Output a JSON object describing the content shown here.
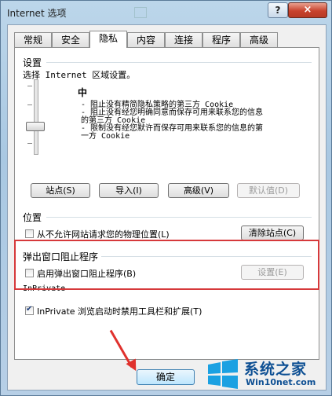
{
  "window": {
    "title": "Internet 选项",
    "help_label": "?",
    "close_label": "×"
  },
  "tabs": [
    "常规",
    "安全",
    "隐私",
    "内容",
    "连接",
    "程序",
    "高级"
  ],
  "active_tab": "隐私",
  "settings": {
    "group_label": "设置",
    "zone_prompt": "选择 Internet 区域设置。",
    "level_name": "中",
    "level_fraction": 0.5,
    "desc_lines": [
      "- 阻止没有精简隐私策略的第三方 Cookie",
      "- 阻止没有经您明确同意而保存可用来联系您的信息",
      "的第三方 Cookie",
      "- 限制没有经您默许而保存可用来联系您的信息的第",
      "一方 Cookie"
    ],
    "buttons": {
      "sites": "站点(S)",
      "import": "导入(I)",
      "advanced": "高级(V)",
      "default": "默认值(D)"
    }
  },
  "location": {
    "group_label": "位置",
    "checkbox_label": "从不允许网站请求您的物理位置(L)",
    "checked": false,
    "clear_button": "清除站点(C)"
  },
  "popup": {
    "group_label": "弹出窗口阻止程序",
    "checkbox_label": "启用弹出窗口阻止程序(B)",
    "checked": false,
    "settings_button": "设置(E)"
  },
  "inprivate": {
    "group_label": "InPrivate",
    "checkbox_label": "InPrivate 浏览启动时禁用工具栏和扩展(T)",
    "checked": true
  },
  "footer": {
    "ok_button": "确定"
  },
  "watermark": {
    "brand": "系统之家",
    "url": "Win10net.com"
  },
  "colors": {
    "annotation_red": "#d6393b",
    "brand_blue": "#0d4f93"
  }
}
